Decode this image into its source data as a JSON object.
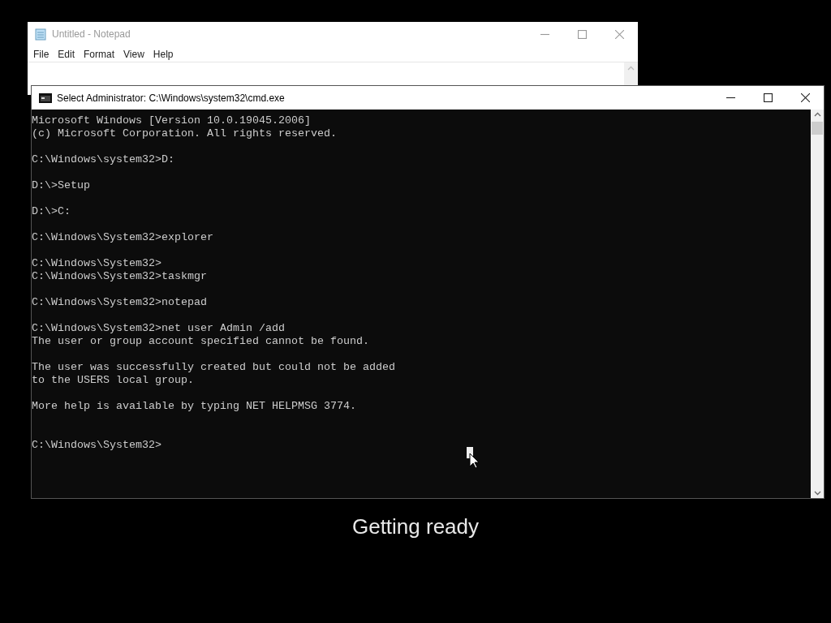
{
  "notepad": {
    "title": "Untitled - Notepad",
    "active": false,
    "menu": [
      "File",
      "Edit",
      "Format",
      "View",
      "Help"
    ]
  },
  "console": {
    "title": "Select Administrator: C:\\Windows\\system32\\cmd.exe",
    "blocks": [
      {
        "lines": [
          "Microsoft Windows [Version 10.0.19045.2006]",
          "(c) Microsoft Corporation. All rights reserved."
        ]
      },
      {
        "lines": [
          "C:\\Windows\\system32>D:"
        ]
      },
      {
        "lines": [
          "D:\\>Setup"
        ]
      },
      {
        "lines": [
          "D:\\>C:"
        ]
      },
      {
        "lines": [
          "C:\\Windows\\System32>explorer"
        ]
      },
      {
        "lines": [
          "C:\\Windows\\System32>",
          "C:\\Windows\\System32>taskmgr"
        ]
      },
      {
        "lines": [
          "C:\\Windows\\System32>notepad"
        ]
      },
      {
        "lines": [
          "C:\\Windows\\System32>net user Admin /add",
          "The user or group account specified cannot be found."
        ]
      },
      {
        "lines": [
          "The user was successfully created but could not be added",
          "to the USERS local group."
        ]
      },
      {
        "lines": [
          "More help is available by typing NET HELPMSG 3774."
        ]
      },
      {
        "kind": "prompt",
        "lines": [
          "C:\\Windows\\System32>"
        ]
      }
    ]
  },
  "status": "Getting ready"
}
